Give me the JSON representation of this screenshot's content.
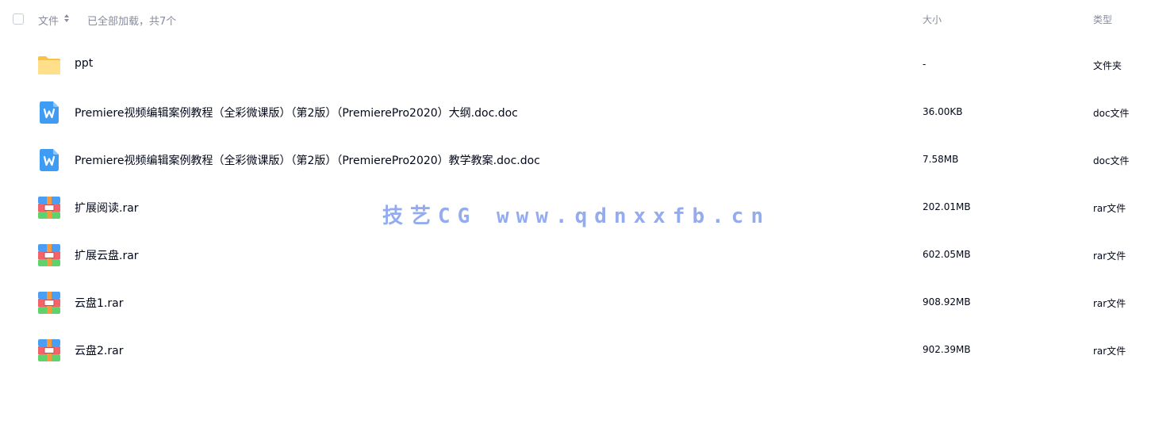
{
  "header": {
    "name_label": "文件",
    "status_text": "已全部加载，共7个",
    "size_label": "大小",
    "type_label": "类型"
  },
  "files": [
    {
      "name": "ppt",
      "size": "-",
      "type": "文件夹",
      "icon": "folder-icon"
    },
    {
      "name": "Premiere视频编辑案例教程（全彩微课版）（第2版）（PremierePro2020）大纲.doc.doc",
      "size": "36.00KB",
      "type": "doc文件",
      "icon": "word-doc-icon"
    },
    {
      "name": "Premiere视频编辑案例教程（全彩微课版）（第2版）（PremierePro2020）教学教案.doc.doc",
      "size": "7.58MB",
      "type": "doc文件",
      "icon": "word-doc-icon"
    },
    {
      "name": "扩展阅读.rar",
      "size": "202.01MB",
      "type": "rar文件",
      "icon": "rar-archive-icon"
    },
    {
      "name": "扩展云盘.rar",
      "size": "602.05MB",
      "type": "rar文件",
      "icon": "rar-archive-icon"
    },
    {
      "name": "云盘1.rar",
      "size": "908.92MB",
      "type": "rar文件",
      "icon": "rar-archive-icon"
    },
    {
      "name": "云盘2.rar",
      "size": "902.39MB",
      "type": "rar文件",
      "icon": "rar-archive-icon"
    }
  ],
  "watermark": "技艺CG www.qdnxxfb.cn",
  "colors": {
    "text": "#03081a",
    "muted": "#878c9c",
    "folder": "#ffd66b",
    "word": "#3f9cf4",
    "watermark": "#8fa8ef"
  }
}
